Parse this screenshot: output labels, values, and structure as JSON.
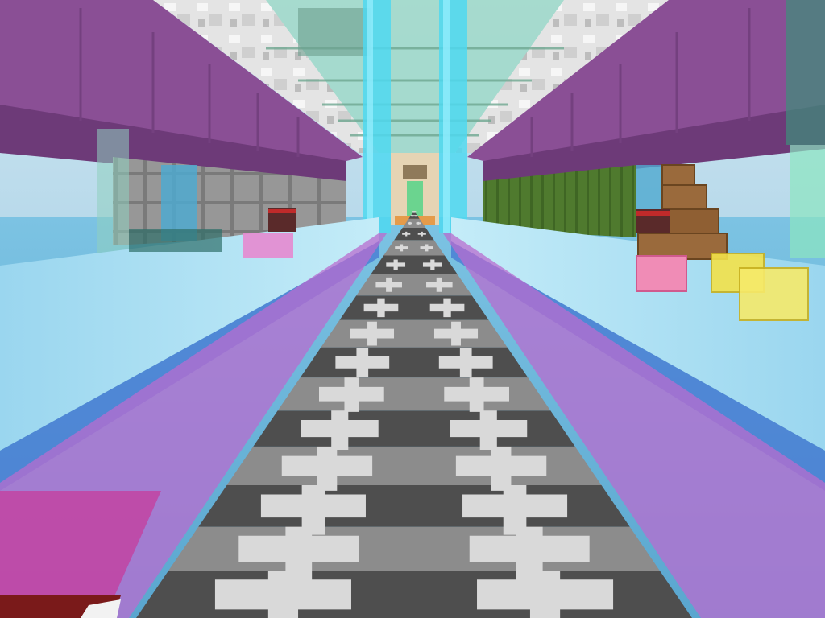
{
  "scene": {
    "type": "first-person-block-world",
    "view": "corridor-runway",
    "sign_label": "",
    "colors": {
      "sky": "#c8e2ef",
      "water": "#6fb8d8",
      "water_light": "#a9dcf0",
      "ceiling_purple": "#8a4f95",
      "purple_glass": "#b86ccf",
      "cyan_pillar": "#4fd8f0",
      "runway_dark": "#4e4e4e",
      "runway_light": "#8c8c8c",
      "runway_mark": "#d9d9d9",
      "green_wall": "#4f7a2e",
      "crate": "#9a6a3c",
      "yellow_block": "#f3e24a",
      "pink_block": "#f08cb6",
      "blue_glass": "#4a7fd4"
    },
    "icons": [
      "plus-mark-icon",
      "crate-icon",
      "yellow-block-icon",
      "pink-block-icon",
      "note-block-icon"
    ]
  }
}
